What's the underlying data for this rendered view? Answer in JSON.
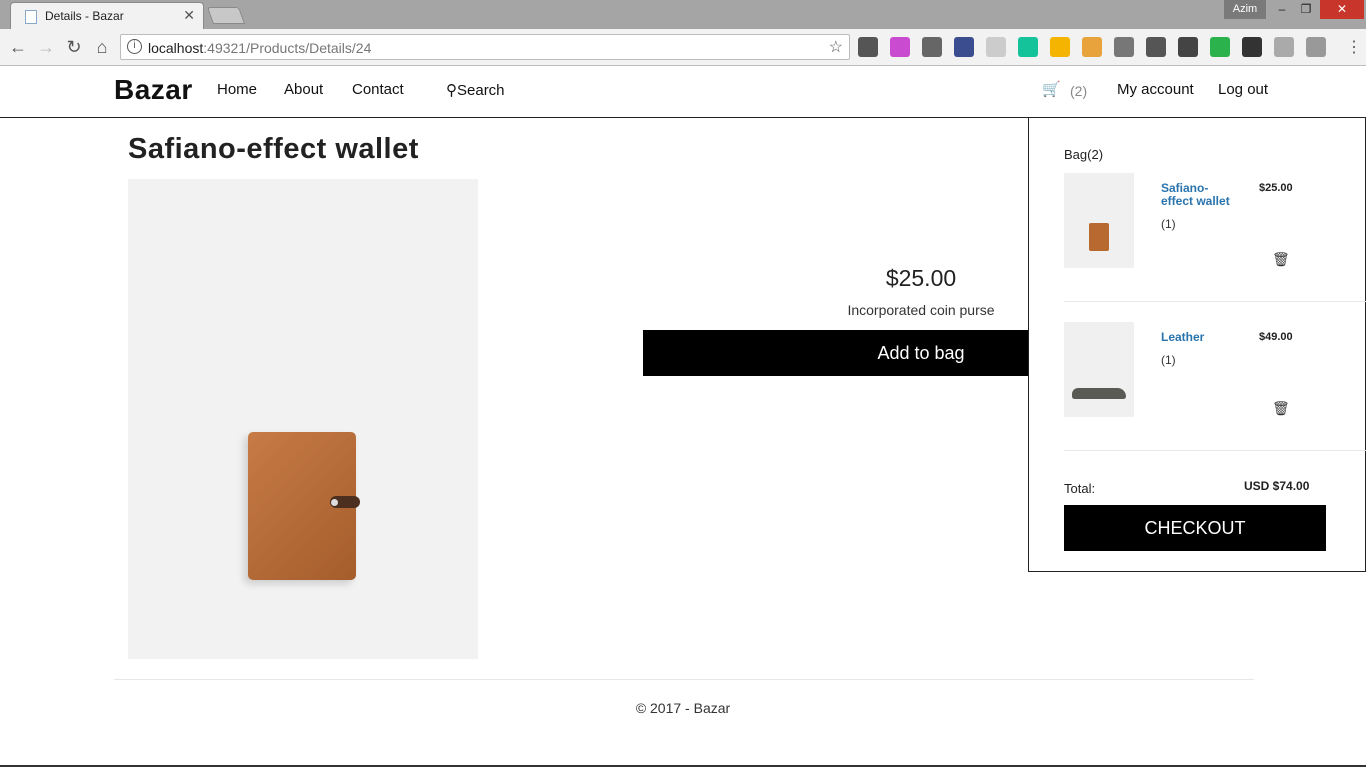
{
  "browser": {
    "tab_title": "Details - Bazar",
    "profile_name": "Azim",
    "url_host": "localhost",
    "url_rest": ":49321/Products/Details/24",
    "extensions": [
      {
        "name": "sync-icon",
        "color": "#555555"
      },
      {
        "name": "gradient-icon",
        "color": "#c94bd0"
      },
      {
        "name": "recycle-icon",
        "color": "#666666"
      },
      {
        "name": "eyedropper-icon",
        "color": "#3c4d8f"
      },
      {
        "name": "grid-icon",
        "color": "#cccccc"
      },
      {
        "name": "grammarly-icon",
        "color": "#15c39a"
      },
      {
        "name": "drive-icon",
        "color": "#f4b400"
      },
      {
        "name": "face-icon",
        "color": "#e8a33d"
      },
      {
        "name": "json-icon",
        "color": "#777777"
      },
      {
        "name": "cast-icon",
        "color": "#555555"
      },
      {
        "name": "badge-icon",
        "color": "#444444"
      },
      {
        "name": "shield-icon",
        "color": "#2bb24c"
      },
      {
        "name": "off-icon",
        "color": "#333333"
      },
      {
        "name": "key-icon",
        "color": "#aaaaaa"
      },
      {
        "name": "dropbox-icon",
        "color": "#999999"
      }
    ]
  },
  "site": {
    "brand": "Bazar",
    "nav": {
      "home": "Home",
      "about": "About",
      "contact": "Contact",
      "search": "Search"
    },
    "cart_count": "(2)",
    "my_account": "My account",
    "log_out": "Log out"
  },
  "product": {
    "title": "Safiano-effect wallet",
    "price": "$25.00",
    "description": "Incorporated coin purse",
    "add_button": "Add to bag"
  },
  "bag": {
    "heading": "Bag(2)",
    "items": [
      {
        "name": "Safiano-effect wallet",
        "qty": "(1)",
        "price": "$25.00"
      },
      {
        "name": "Leather",
        "qty": "(1)",
        "price": "$49.00"
      }
    ],
    "total_label": "Total:",
    "total_value": "USD $74.00",
    "checkout": "CHECKOUT"
  },
  "footer": {
    "text": "© 2017 - Bazar"
  }
}
